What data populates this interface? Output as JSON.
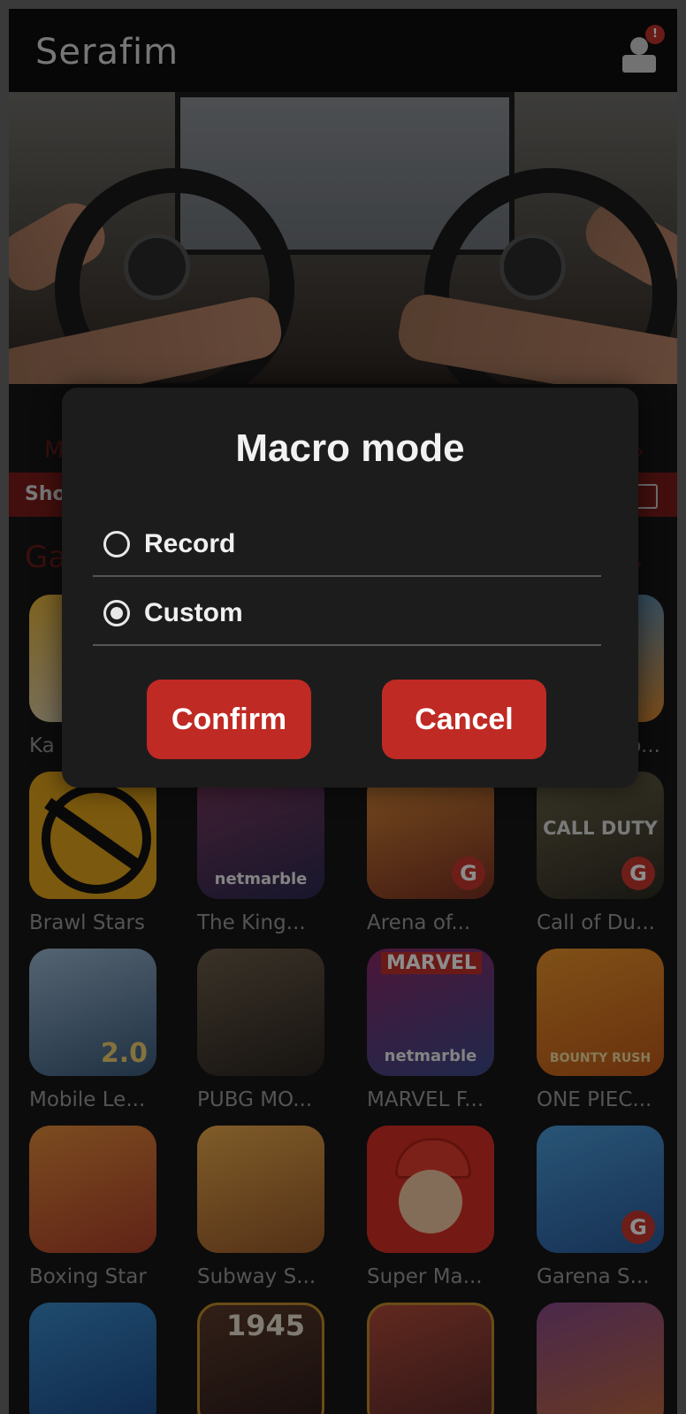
{
  "app": {
    "title": "Serafim",
    "notification_count": "!"
  },
  "banner": {
    "slides": 5,
    "active_slide": 5
  },
  "background_hints": {
    "section_letter_m": "M",
    "redbar_text": "Sho",
    "section_letter_g": "Ga",
    "tile_partial_left": "Ka",
    "tile_partial_right": "o..."
  },
  "dialog": {
    "title": "Macro mode",
    "options": [
      {
        "label": "Record",
        "selected": false
      },
      {
        "label": "Custom",
        "selected": true
      }
    ],
    "confirm_label": "Confirm",
    "cancel_label": "Cancel"
  },
  "games": [
    {
      "name": "Brawl Stars",
      "icon": "brawl-stars-icon",
      "color": "#e0a21a"
    },
    {
      "name": "The King...",
      "icon": "kof-icon",
      "color": "#4a3c6e"
    },
    {
      "name": "Arena of...",
      "icon": "arena-of-valor-icon",
      "color": "#b54a2a"
    },
    {
      "name": "Call of Du...",
      "icon": "call-of-duty-icon",
      "color": "#4a4534"
    },
    {
      "name": "Mobile Le...",
      "icon": "mobile-legends-icon",
      "color": "#6a8fb0"
    },
    {
      "name": "PUBG MO...",
      "icon": "pubg-icon",
      "color": "#5b4c3a"
    },
    {
      "name": "MARVEL F...",
      "icon": "marvel-icon",
      "color": "#9a3030"
    },
    {
      "name": "ONE PIEC...",
      "icon": "one-piece-icon",
      "color": "#e06b1f"
    },
    {
      "name": "Boxing Star",
      "icon": "boxing-star-icon",
      "color": "#d96a2a"
    },
    {
      "name": "Subway S...",
      "icon": "subway-surfers-icon",
      "color": "#d48a2a"
    },
    {
      "name": "Super Ma...",
      "icon": "super-mario-icon",
      "color": "#d62f25"
    },
    {
      "name": "Garena S...",
      "icon": "garena-speed-icon",
      "color": "#3a85c9"
    }
  ],
  "icon_texts": {
    "brand": "netmarble",
    "cod": "CALL DUTY",
    "marvel": "MARVEL",
    "ml": "2.0",
    "op": "BOUNTY RUSH",
    "g": "G",
    "year": "1945"
  }
}
